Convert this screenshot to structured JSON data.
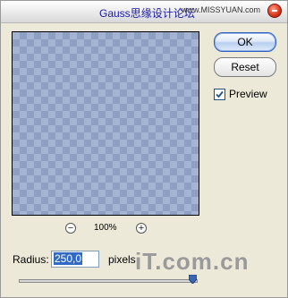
{
  "window": {
    "title": "Gauss",
    "watermark": "思缘设计论坛",
    "site": "www.MISSYUAN.com"
  },
  "zoom": {
    "minus": "−",
    "level": "100%",
    "plus": "+"
  },
  "buttons": {
    "ok": "OK",
    "reset": "Reset"
  },
  "preview_option": {
    "label": "Preview",
    "checked": true
  },
  "radius": {
    "label": "Radius:",
    "value": "250,0",
    "unit": "pixels",
    "slider_fraction": 0.97
  },
  "logo": "iT.com.cn"
}
